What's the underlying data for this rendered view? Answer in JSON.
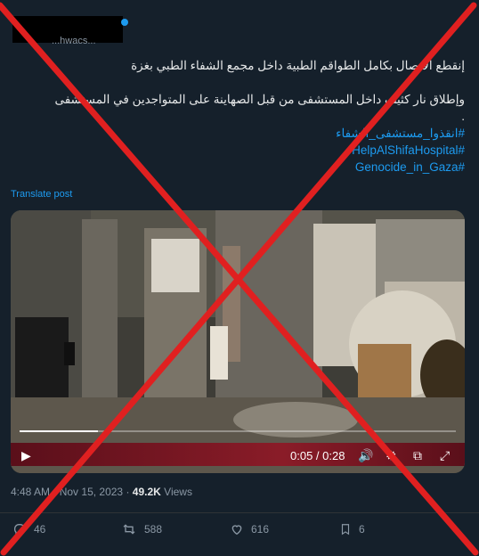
{
  "author": {
    "handle_fragment": "...hwacs..."
  },
  "tweet": {
    "lines": [
      "إنقطع الاتصال بكامل الطواقم الطبية داخل مجمع الشفاء الطبي بغزة",
      "",
      "وإطلاق نار كثيف داخل المستشفى من قبل الصهاينة على المتواجدين في المستشفى",
      "."
    ],
    "hashtags": [
      "#انقذوا_مستشفى_الشفاء",
      "#HelpAlShifaHospital",
      "#Genocide_in_Gaza"
    ],
    "translate_label": "Translate post"
  },
  "video": {
    "time_label": "0:05 / 0:28",
    "progress": 0.18
  },
  "meta": {
    "time": "4:48 AM",
    "sep": "·",
    "date": "Nov 15, 2023",
    "views_count": "49.2K",
    "views_label": "Views"
  },
  "actions": {
    "replies": "46",
    "reposts": "588",
    "likes": "616",
    "bookmarks": "6"
  },
  "overlay": {
    "color": "#e02020"
  }
}
